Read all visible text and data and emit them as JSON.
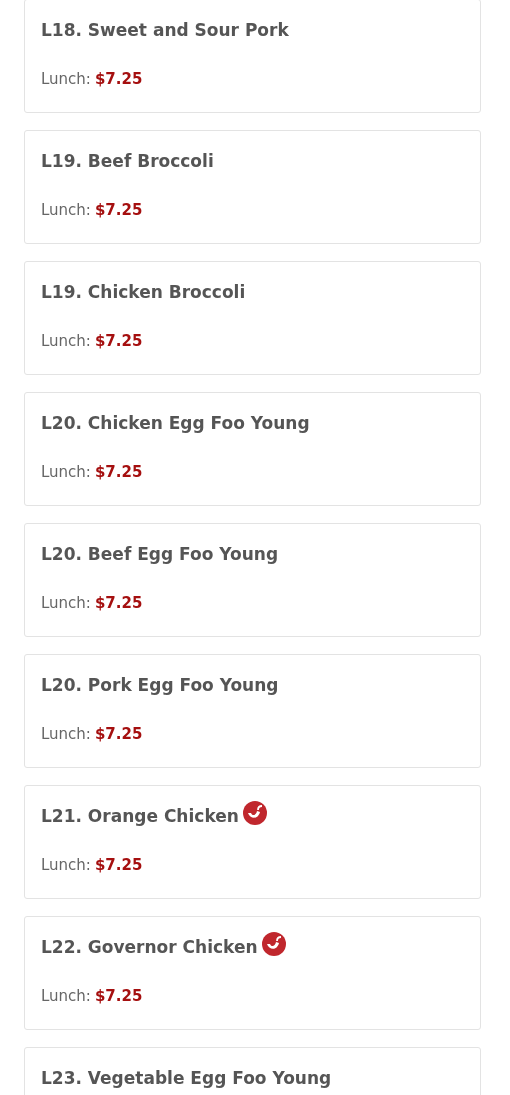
{
  "menu_items": [
    {
      "title": "L18. Sweet and Sour Pork",
      "spicy": false,
      "price_label": "Lunch:",
      "price": "$7.25"
    },
    {
      "title": "L19. Beef Broccoli",
      "spicy": false,
      "price_label": "Lunch:",
      "price": "$7.25"
    },
    {
      "title": "L19. Chicken Broccoli",
      "spicy": false,
      "price_label": "Lunch:",
      "price": "$7.25"
    },
    {
      "title": "L20. Chicken Egg Foo Young",
      "spicy": false,
      "price_label": "Lunch:",
      "price": "$7.25"
    },
    {
      "title": "L20. Beef Egg Foo Young",
      "spicy": false,
      "price_label": "Lunch:",
      "price": "$7.25"
    },
    {
      "title": "L20. Pork Egg Foo Young",
      "spicy": false,
      "price_label": "Lunch:",
      "price": "$7.25"
    },
    {
      "title": "L21. Orange Chicken",
      "spicy": true,
      "price_label": "Lunch:",
      "price": "$7.25"
    },
    {
      "title": "L22. Governor Chicken",
      "spicy": true,
      "price_label": "Lunch:",
      "price": "$7.25"
    },
    {
      "title": "L23. Vegetable Egg Foo Young",
      "spicy": false
    }
  ]
}
